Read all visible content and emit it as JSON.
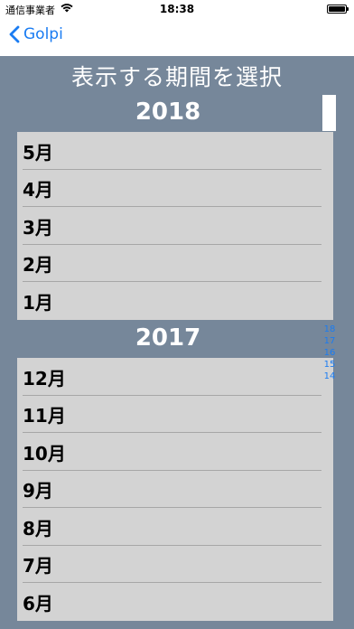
{
  "status_bar": {
    "carrier": "通信事業者",
    "time": "18:38",
    "battery_level": 1.0
  },
  "nav": {
    "back_label": "Golpi"
  },
  "page": {
    "title": "表示する期間を選択"
  },
  "sections": [
    {
      "year": "2018",
      "months": [
        "5月",
        "4月",
        "3月",
        "2月",
        "1月"
      ]
    },
    {
      "year": "2017",
      "months": [
        "12月",
        "11月",
        "10月",
        "9月",
        "8月",
        "7月",
        "6月"
      ]
    }
  ],
  "section_index": [
    "18",
    "17",
    "16",
    "15",
    "14"
  ],
  "colors": {
    "background": "#76879a",
    "cell": "#d3d3d3",
    "accent": "#1a7cf2"
  }
}
